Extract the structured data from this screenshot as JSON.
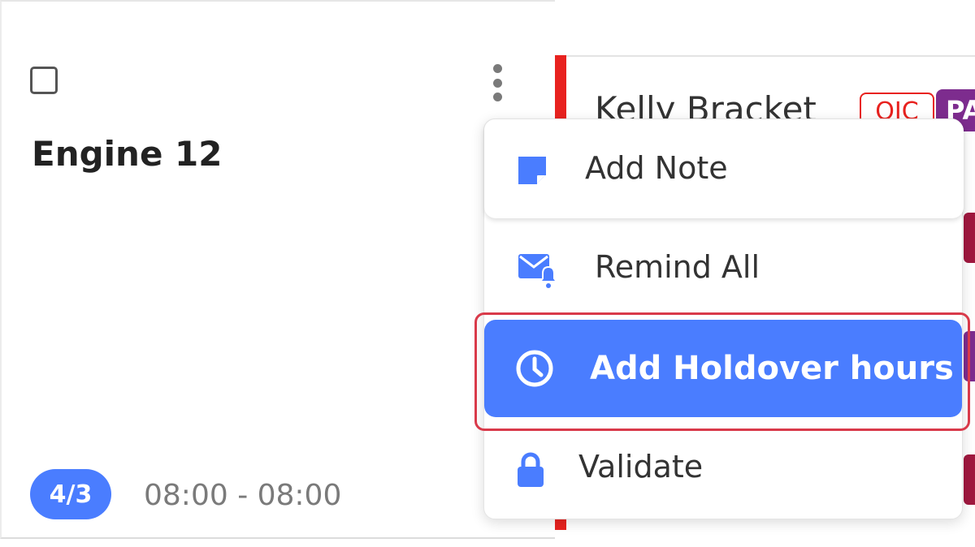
{
  "unit_card": {
    "title": "Engine 12",
    "staffing_badge": "4/3",
    "shift_time": "08:00 - 08:00"
  },
  "roster": {
    "first_member_name": "Kelly Bracket",
    "oic_badge": "OIC",
    "rank_badge": "PA",
    "accent_color": "#e8221f"
  },
  "menu": {
    "items": [
      {
        "label": "Add Note",
        "icon": "note-icon"
      },
      {
        "label": "Remind All",
        "icon": "mail-bell-icon"
      },
      {
        "label": "Add Holdover hours",
        "icon": "clock-icon",
        "highlighted": true
      },
      {
        "label": "Validate",
        "icon": "lock-icon"
      }
    ],
    "highlight_color": "#4a7dff",
    "focus_outline_color": "#d93a4a"
  }
}
